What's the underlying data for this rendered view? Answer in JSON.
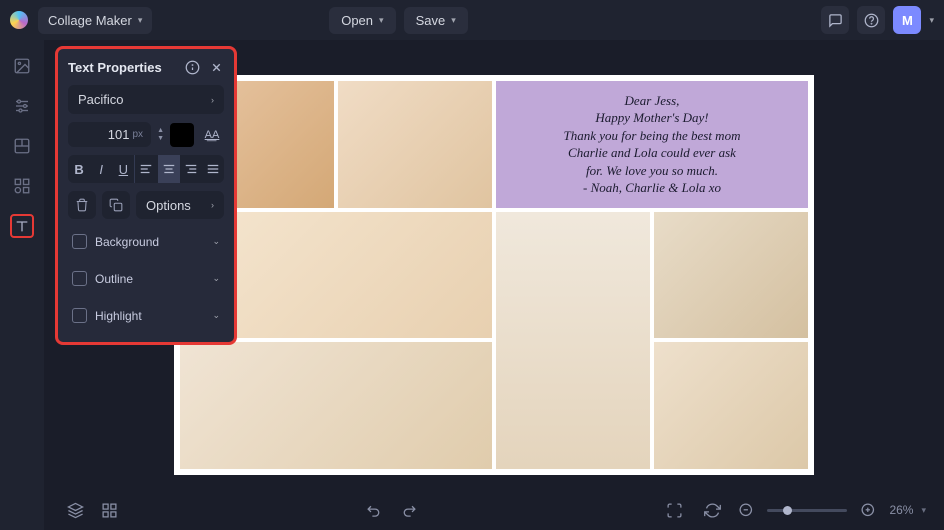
{
  "header": {
    "app_name": "Collage Maker",
    "open_label": "Open",
    "save_label": "Save",
    "avatar_initial": "M"
  },
  "text_panel": {
    "title": "Text Properties",
    "font_family": "Pacifico",
    "font_size": "101",
    "font_unit": "px",
    "options_label": "Options",
    "sections": {
      "background": "Background",
      "outline": "Outline",
      "highlight": "Highlight"
    }
  },
  "collage_text": {
    "line1": "Dear Jess,",
    "line2": "Happy Mother's Day!",
    "line3": "Thank you for being the best mom",
    "line4": "Charlie and Lola could ever ask",
    "line5": "for. We love you so much.",
    "line6": "- Noah, Charlie & Lola  xo"
  },
  "footer": {
    "zoom_value": "26%"
  }
}
